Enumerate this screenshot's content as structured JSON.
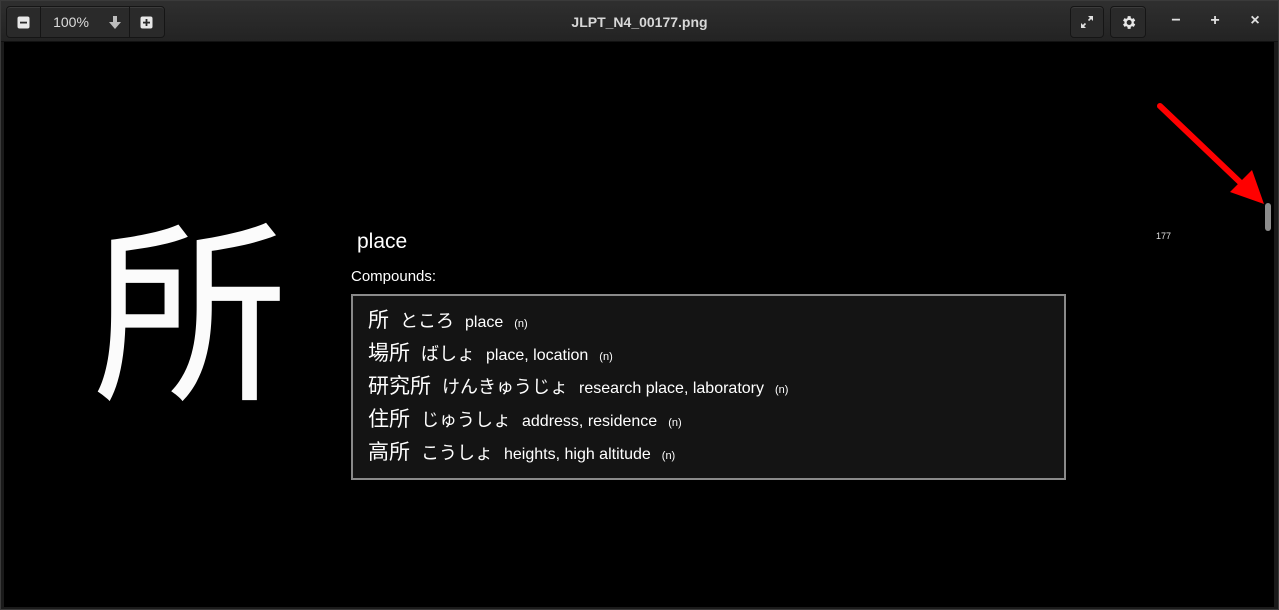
{
  "window": {
    "title": "JLPT_N4_00177.png",
    "zoom_label": "100%"
  },
  "toolbar": {
    "zoom_out_icon": "minus-square-icon",
    "zoom_dropdown_icon": "arrow-down-icon",
    "zoom_in_icon": "plus-square-icon",
    "fullscreen_icon": "expand-icon",
    "settings_icon": "gear-icon"
  },
  "window_controls": {
    "minimize": "−",
    "maximize": "+",
    "close": "×"
  },
  "card": {
    "kanji": "所",
    "meaning": "place",
    "compounds_label": "Compounds:",
    "number": "177",
    "compounds": [
      {
        "kanji": "所",
        "kana": "ところ",
        "gloss": "place",
        "pos": "(n)"
      },
      {
        "kanji": "場所",
        "kana": "ばしょ",
        "gloss": "place, location",
        "pos": "(n)"
      },
      {
        "kanji": "研究所",
        "kana": "けんきゅうじょ",
        "gloss": "research place, laboratory",
        "pos": "(n)"
      },
      {
        "kanji": "住所",
        "kana": "じゅうしょ",
        "gloss": "address, residence",
        "pos": "(n)"
      },
      {
        "kanji": "高所",
        "kana": "こうしょ",
        "gloss": "heights, high altitude",
        "pos": "(n)"
      }
    ]
  },
  "colors": {
    "background": "#000000",
    "text": "#ffffff",
    "arrow": "#ff0000",
    "box_border": "#8a8a8a"
  }
}
